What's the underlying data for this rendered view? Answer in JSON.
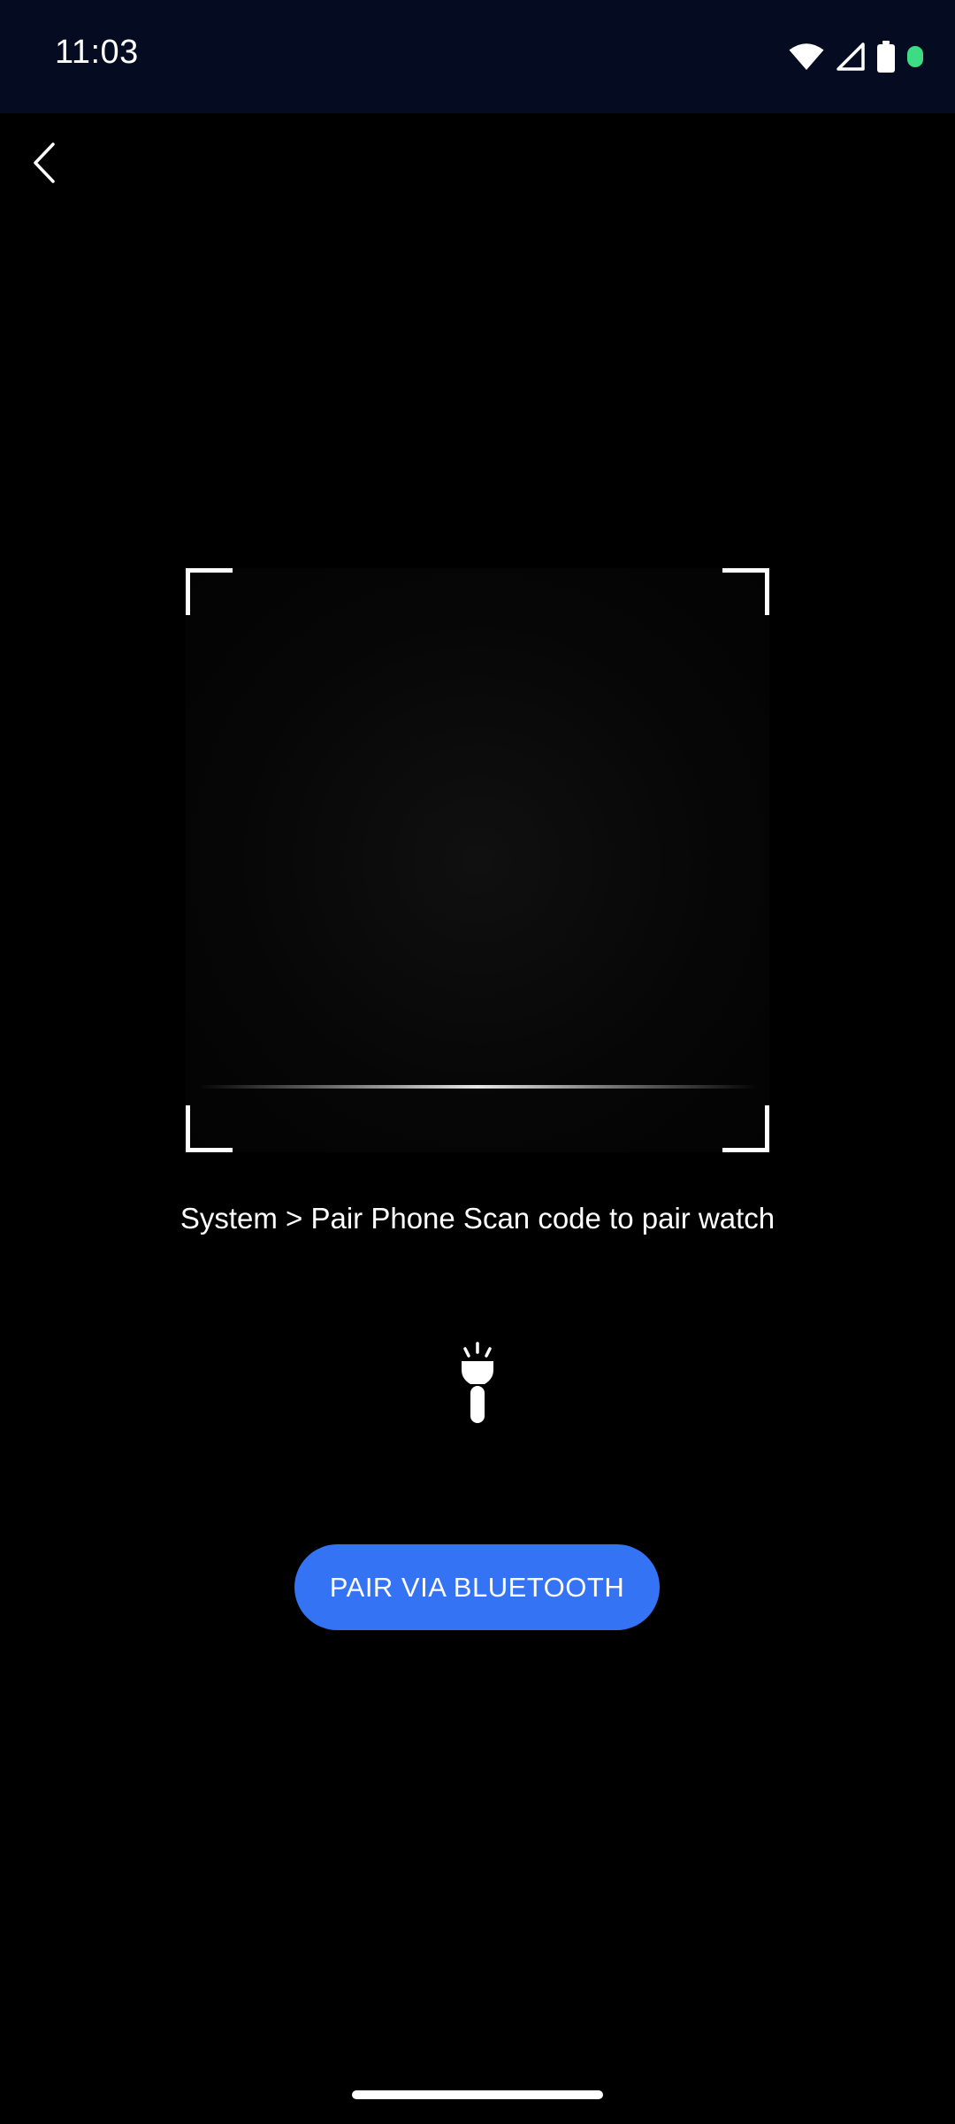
{
  "status_bar": {
    "time": "11:03",
    "icons": [
      "wifi-icon",
      "cellular-signal-icon",
      "battery-icon",
      "camera-in-use-dot"
    ],
    "background": "#050b21",
    "indicator_color": "#3ddc84"
  },
  "navigation": {
    "back_icon": "chevron-left-icon"
  },
  "scanner": {
    "instruction": "System > Pair Phone Scan code to pair watch"
  },
  "flashlight": {
    "icon": "flashlight-icon"
  },
  "pair_button": {
    "label": "PAIR VIA BLUETOOTH",
    "color": "#3373f4"
  }
}
